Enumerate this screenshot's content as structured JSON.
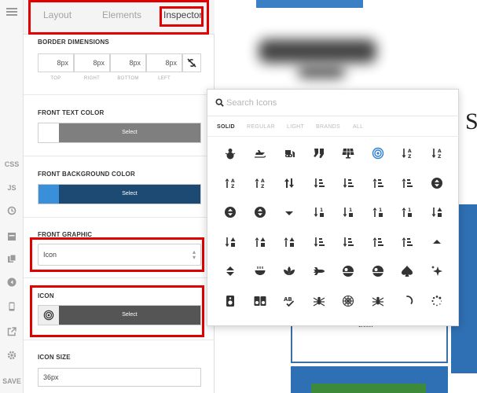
{
  "rail": {
    "labels": [
      "CSS",
      "JS",
      "SAVE"
    ]
  },
  "tabs": {
    "layout": "Layout",
    "elements": "Elements",
    "inspector": "Inspector"
  },
  "border_dimensions": {
    "title": "BORDER DIMENSIONS",
    "fields": [
      {
        "value": "8px",
        "caption": "TOP"
      },
      {
        "value": "8px",
        "caption": "RIGHT"
      },
      {
        "value": "8px",
        "caption": "BOTTOM"
      },
      {
        "value": "8px",
        "caption": "LEFT"
      }
    ]
  },
  "front_text_color": {
    "title": "FRONT TEXT COLOR",
    "swatch": "#ffffff",
    "button_color": "#7f7f7f",
    "button_label": "Select"
  },
  "front_background_color": {
    "title": "FRONT BACKGROUND COLOR",
    "swatch": "#3a8fd9",
    "button_color": "#1d4a72",
    "button_label": "Select"
  },
  "front_graphic": {
    "title": "FRONT GRAPHIC",
    "selected": "Icon"
  },
  "icon": {
    "title": "ICON",
    "button_color": "#555555",
    "button_label": "Select"
  },
  "icon_size": {
    "title": "ICON SIZE",
    "value": "36px"
  },
  "icon_picker": {
    "search_placeholder": "Search Icons",
    "style_tabs": [
      "SOLID",
      "REGULAR",
      "LIGHT",
      "BRANDS",
      "ALL"
    ],
    "active_style": "SOLID",
    "icons": [
      [
        "snowman-icon",
        "snowmobile-icon",
        "snowplow-icon",
        "socks-icon",
        "solar-panel-icon",
        "soap-icon",
        "sort-alpha-down-icon",
        "sort-alpha-down-alt-icon"
      ],
      [
        "sort-alpha-up-icon",
        "sort-alpha-up-alt-icon",
        "sort-icon",
        "sort-amount-down-icon",
        "sort-amount-down-alt-icon",
        "sort-amount-up-icon",
        "sort-amount-up-alt-icon",
        "sort-circle-icon"
      ],
      [
        "sort-circle-down-icon",
        "sort-circle-up-icon",
        "sort-down-icon",
        "sort-numeric-down-icon",
        "sort-numeric-down-alt-icon",
        "sort-numeric-up-icon",
        "sort-numeric-up-alt-icon",
        "sort-shapes-down-icon"
      ],
      [
        "sort-shapes-down-alt-icon",
        "sort-shapes-up-icon",
        "sort-shapes-up-alt-icon",
        "sort-size-down-icon",
        "sort-size-down-alt-icon",
        "sort-size-up-icon",
        "sort-size-up-alt-icon",
        "sort-up-icon"
      ],
      [
        "sort-up-down-icon",
        "soup-icon",
        "spa-icon",
        "space-shuttle-icon",
        "space-station-moon-icon",
        "space-station-moon-alt-icon",
        "spade-icon",
        "sparkles-icon"
      ],
      [
        "speaker-icon",
        "speakers-icon",
        "spell-check-icon",
        "spider-icon",
        "spider-web-icon",
        "spider-black-widow-icon",
        "spinner-third-icon",
        "spinner-icon"
      ]
    ]
  },
  "canvas": {
    "heading_glyph": "S",
    "card_text": "Best!"
  }
}
